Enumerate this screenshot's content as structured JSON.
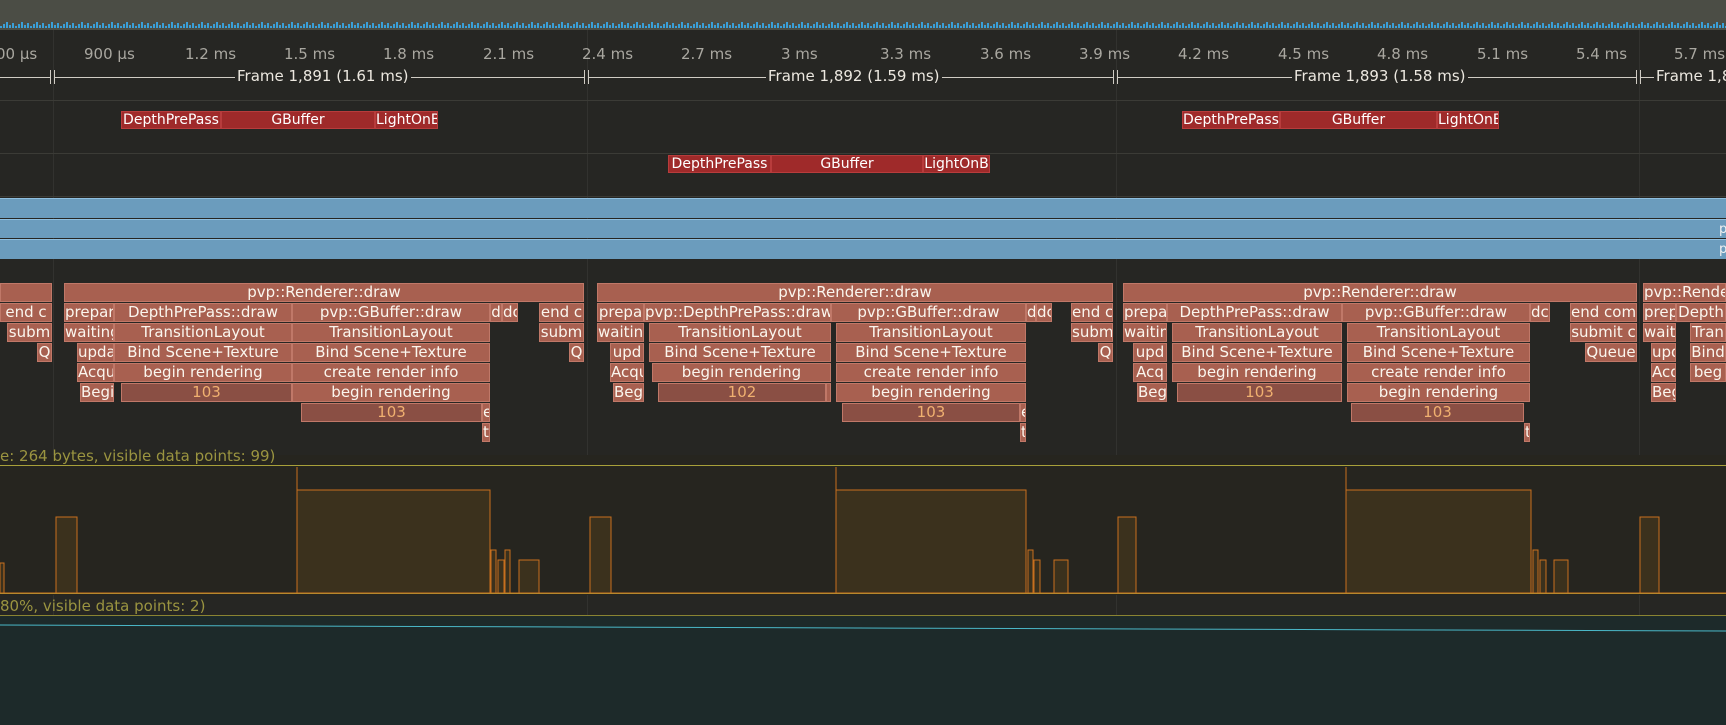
{
  "ticks": [
    "00 µs",
    "900 µs",
    "1.2 ms",
    "1.5 ms",
    "1.8 ms",
    "2.1 ms",
    "2.4 ms",
    "2.7 ms",
    "3 ms",
    "3.3 ms",
    "3.6 ms",
    "3.9 ms",
    "4.2 ms",
    "4.5 ms",
    "4.8 ms",
    "5.1 ms",
    "5.4 ms",
    "5.7 ms"
  ],
  "frames": {
    "f1891": "Frame 1,891 (1.61 ms)",
    "f1892": "Frame 1,892 (1.59 ms)",
    "f1893": "Frame 1,893 (1.58 ms)",
    "f1894": "Frame 1,8"
  },
  "gpu": {
    "depth": "DepthPrePass",
    "gbuffer": "GBuffer",
    "light": "LightOnB"
  },
  "blue": {
    "p1": "p",
    "p2": "p"
  },
  "zones": {
    "draw": "pvp::Renderer::draw",
    "end_co": "end co",
    "end_com": "end com",
    "subm": "subm",
    "submit": "submit c",
    "q": "Q",
    "queue": "Queue",
    "prepa": "prepa",
    "prepar": "prepar",
    "waiting": "waiting",
    "waitin": "waitin",
    "upd": "upd",
    "upda": "upda",
    "acq": "Acq",
    "acqu": "Acqu",
    "beg": "Beg",
    "begi": "Begi",
    "depth_draw": "DepthPrePass::draw",
    "pvp_depth_draw": "pvp::DepthPrePass::draw",
    "depth_short": "Depth",
    "gbuffer_draw": "pvp::GBuffer::draw",
    "transition": "TransitionLayout",
    "tran": "Tran",
    "bind": "Bind Scene+Texture",
    "bind_short": "Bind",
    "create": "create render info",
    "begin_rendering": "begin rendering",
    "beg_short": "beg",
    "dcc": "dcc",
    "dc": "dc",
    "d": "d",
    "e": "e",
    "t": "t",
    "bracket": "[",
    "n103": "103",
    "n102": "102",
    "end_e": "end c"
  },
  "plot1_label": "e: 264 bytes, visible data points: 99)",
  "plot2_label": "80%, visible data points: 2)",
  "colors": {
    "gpu_zone": "#9f2a2a",
    "cpu_zone": "#a86050",
    "blue_track": "#6b9cbd",
    "plot_line": "#c8701e",
    "plot_fill": "#4a3a1c",
    "bottom_line": "#4ab8c8"
  }
}
